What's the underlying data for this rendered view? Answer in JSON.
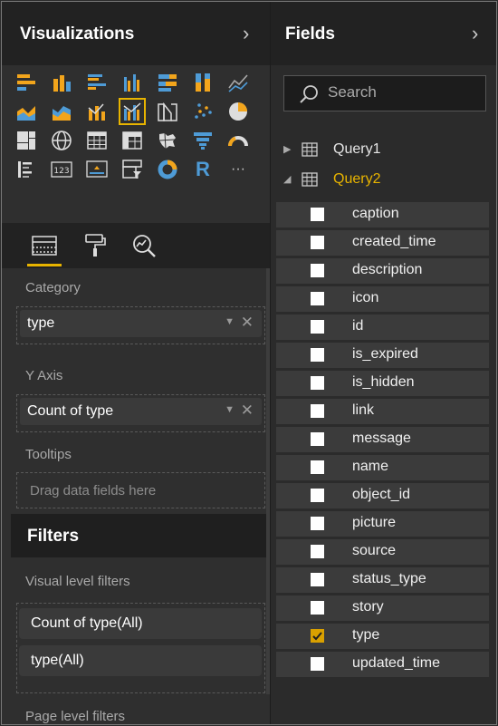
{
  "visualizations": {
    "title": "Visualizations",
    "icons": [
      "stacked-bar-icon",
      "stacked-column-icon",
      "clustered-bar-icon",
      "clustered-column-icon",
      "hundred-percent-bar-icon",
      "hundred-percent-column-icon",
      "line-chart-icon",
      "area-chart-icon",
      "stacked-area-icon",
      "line-column-icon",
      "line-clustered-column-icon",
      "ribbon-chart-icon",
      "scatter-chart-icon",
      "pie-chart-icon",
      "treemap-icon",
      "map-icon",
      "table-icon",
      "matrix-icon",
      "filled-map-icon",
      "funnel-icon",
      "gauge-icon",
      "multi-row-card-icon",
      "card-icon",
      "kpi-icon",
      "slicer-icon",
      "donut-icon",
      "r-visual-icon",
      "more-icon"
    ],
    "r_label": "R",
    "more_label": "···",
    "selected_icon": "line-clustered-column-icon",
    "category": {
      "label": "Category",
      "value": "type"
    },
    "y_axis": {
      "label": "Y Axis",
      "value": "Count of type"
    },
    "tooltips": {
      "label": "Tooltips",
      "placeholder": "Drag data fields here"
    },
    "filters": {
      "title": "Filters",
      "visual_level_label": "Visual level filters",
      "visual_level_items": [
        "Count of type(All)",
        "type(All)"
      ],
      "page_level_label": "Page level filters"
    }
  },
  "fields": {
    "title": "Fields",
    "search_placeholder": "Search",
    "queries": [
      {
        "name": "Query1",
        "expanded": false,
        "color": "#e6e6e6"
      },
      {
        "name": "Query2",
        "expanded": true,
        "color": "#e8b400"
      }
    ],
    "items": [
      {
        "label": "caption",
        "checked": false
      },
      {
        "label": "created_time",
        "checked": false
      },
      {
        "label": "description",
        "checked": false
      },
      {
        "label": "icon",
        "checked": false
      },
      {
        "label": "id",
        "checked": false
      },
      {
        "label": "is_expired",
        "checked": false
      },
      {
        "label": "is_hidden",
        "checked": false
      },
      {
        "label": "link",
        "checked": false
      },
      {
        "label": "message",
        "checked": false
      },
      {
        "label": "name",
        "checked": false
      },
      {
        "label": "object_id",
        "checked": false
      },
      {
        "label": "picture",
        "checked": false
      },
      {
        "label": "source",
        "checked": false
      },
      {
        "label": "status_type",
        "checked": false
      },
      {
        "label": "story",
        "checked": false
      },
      {
        "label": "type",
        "checked": true
      },
      {
        "label": "updated_time",
        "checked": false
      }
    ]
  },
  "colors": {
    "accent": "#e8b400",
    "check": "#d9a000",
    "panel": "#2f2f2f",
    "header": "#222222"
  }
}
